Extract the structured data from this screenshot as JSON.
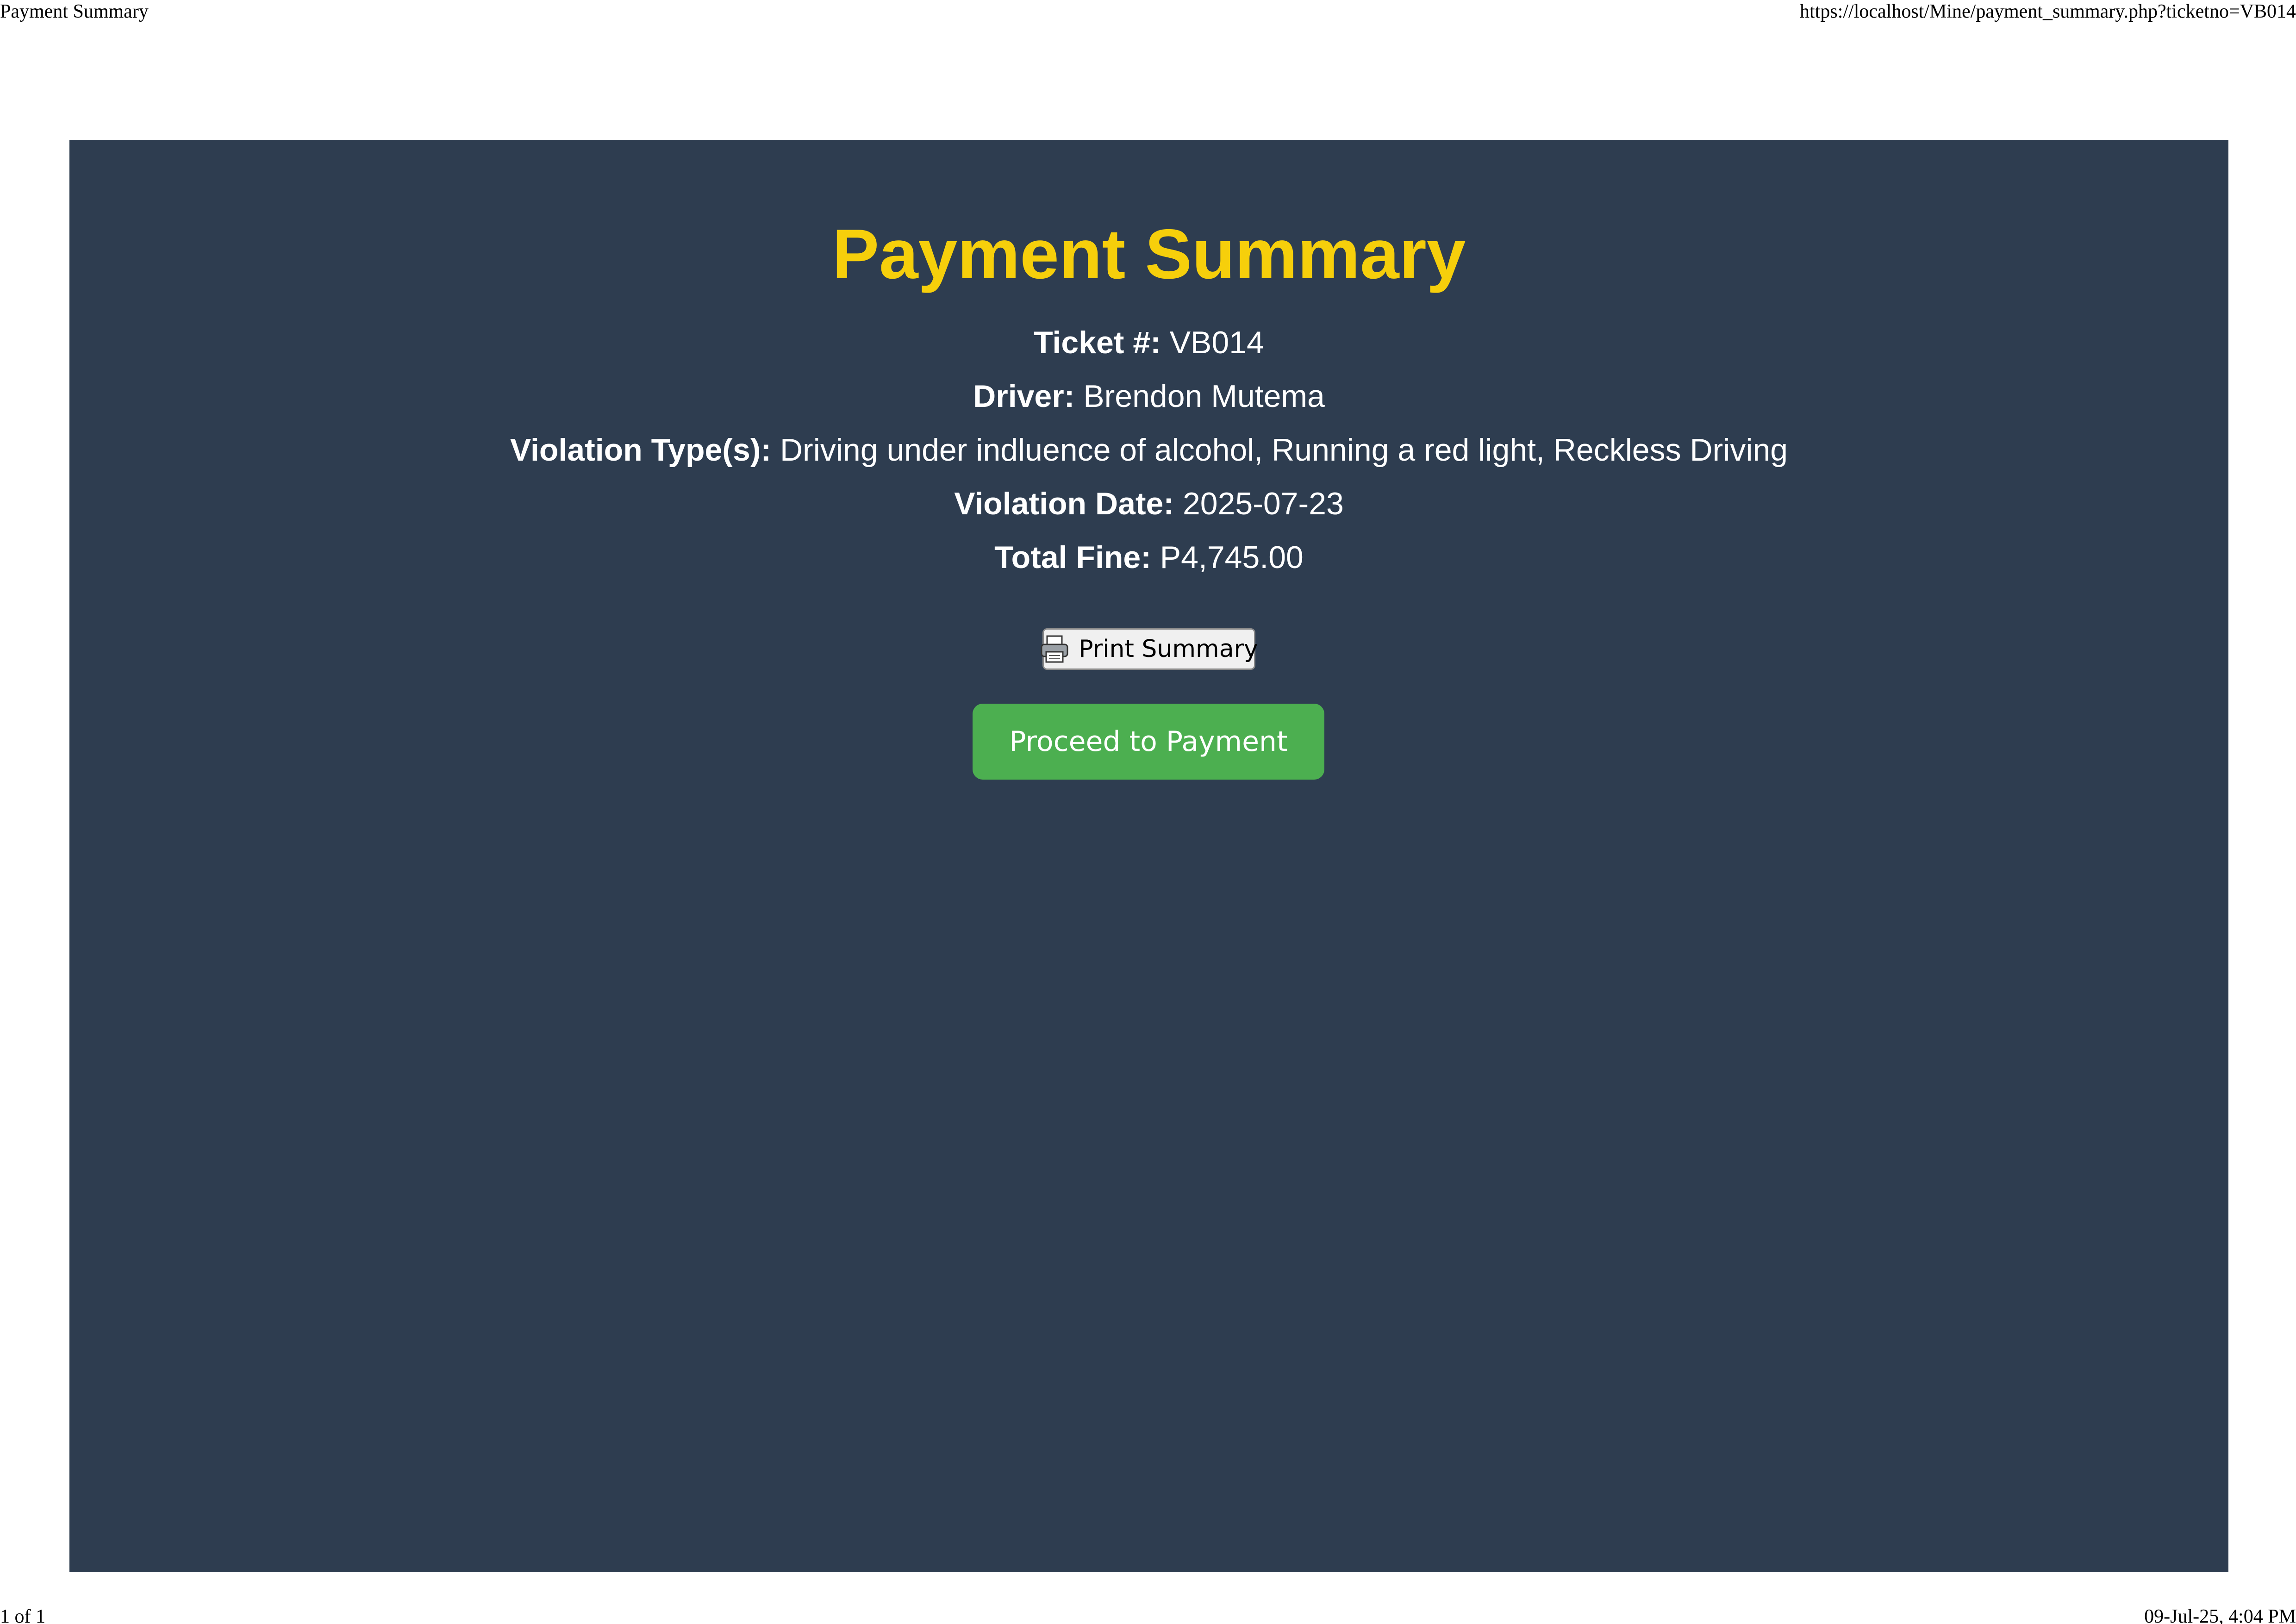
{
  "print_header": {
    "title": "Payment Summary",
    "url": "https://localhost/Mine/payment_summary.php?ticketno=VB014"
  },
  "print_footer": {
    "page": "1 of 1",
    "datetime": "09-Jul-25, 4:04 PM"
  },
  "summary": {
    "title": "Payment Summary",
    "ticket_label": "Ticket #:",
    "ticket_value": "VB014",
    "driver_label": "Driver:",
    "driver_value": "Brendon Mutema",
    "violation_type_label": "Violation Type(s):",
    "violation_type_value": "Driving under indluence of alcohol, Running a red light, Reckless Driving",
    "violation_date_label": "Violation Date:",
    "violation_date_value": "2025-07-23",
    "total_fine_label": "Total Fine:",
    "total_fine_value": "P4,745.00"
  },
  "actions": {
    "print_label": "Print Summary",
    "print_icon": "printer-icon",
    "pay_label": "Proceed to Payment"
  },
  "colors": {
    "panel_bg": "#2e3d50",
    "title": "#f6cf0b",
    "pay_button": "#4caf50"
  }
}
